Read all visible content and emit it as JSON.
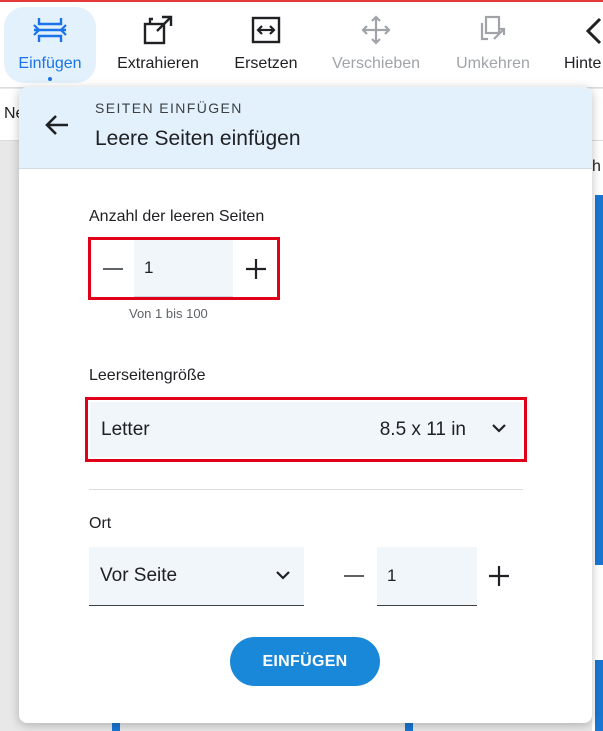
{
  "toolbar": {
    "items": [
      {
        "label": "Einfügen",
        "icon": "insert-pages-icon",
        "state": "active"
      },
      {
        "label": "Extrahieren",
        "icon": "extract-icon",
        "state": "normal"
      },
      {
        "label": "Ersetzen",
        "icon": "replace-icon",
        "state": "normal"
      },
      {
        "label": "Verschieben",
        "icon": "move-icon",
        "state": "disabled"
      },
      {
        "label": "Umkehren",
        "icon": "reverse-icon",
        "state": "disabled"
      },
      {
        "label": "Hinte",
        "icon": "background-icon",
        "state": "normal"
      }
    ]
  },
  "background": {
    "left_fragment": "Ne",
    "right_fragment": "h"
  },
  "panel": {
    "overline": "SEITEN EINFÜGEN",
    "title": "Leere Seiten einfügen",
    "count": {
      "label": "Anzahl der leeren Seiten",
      "value": "1",
      "hint": "Von 1 bis 100"
    },
    "size": {
      "label": "Leerseitengröße",
      "value": "Letter",
      "dimensions": "8.5 x 11 in"
    },
    "location": {
      "label": "Ort",
      "position": "Vor Seite",
      "page": "1"
    },
    "submit_label": "EINFÜGEN"
  },
  "colors": {
    "accent": "#1a88d8",
    "highlight": "#e0001a",
    "header_bg": "#e3f1fd"
  }
}
